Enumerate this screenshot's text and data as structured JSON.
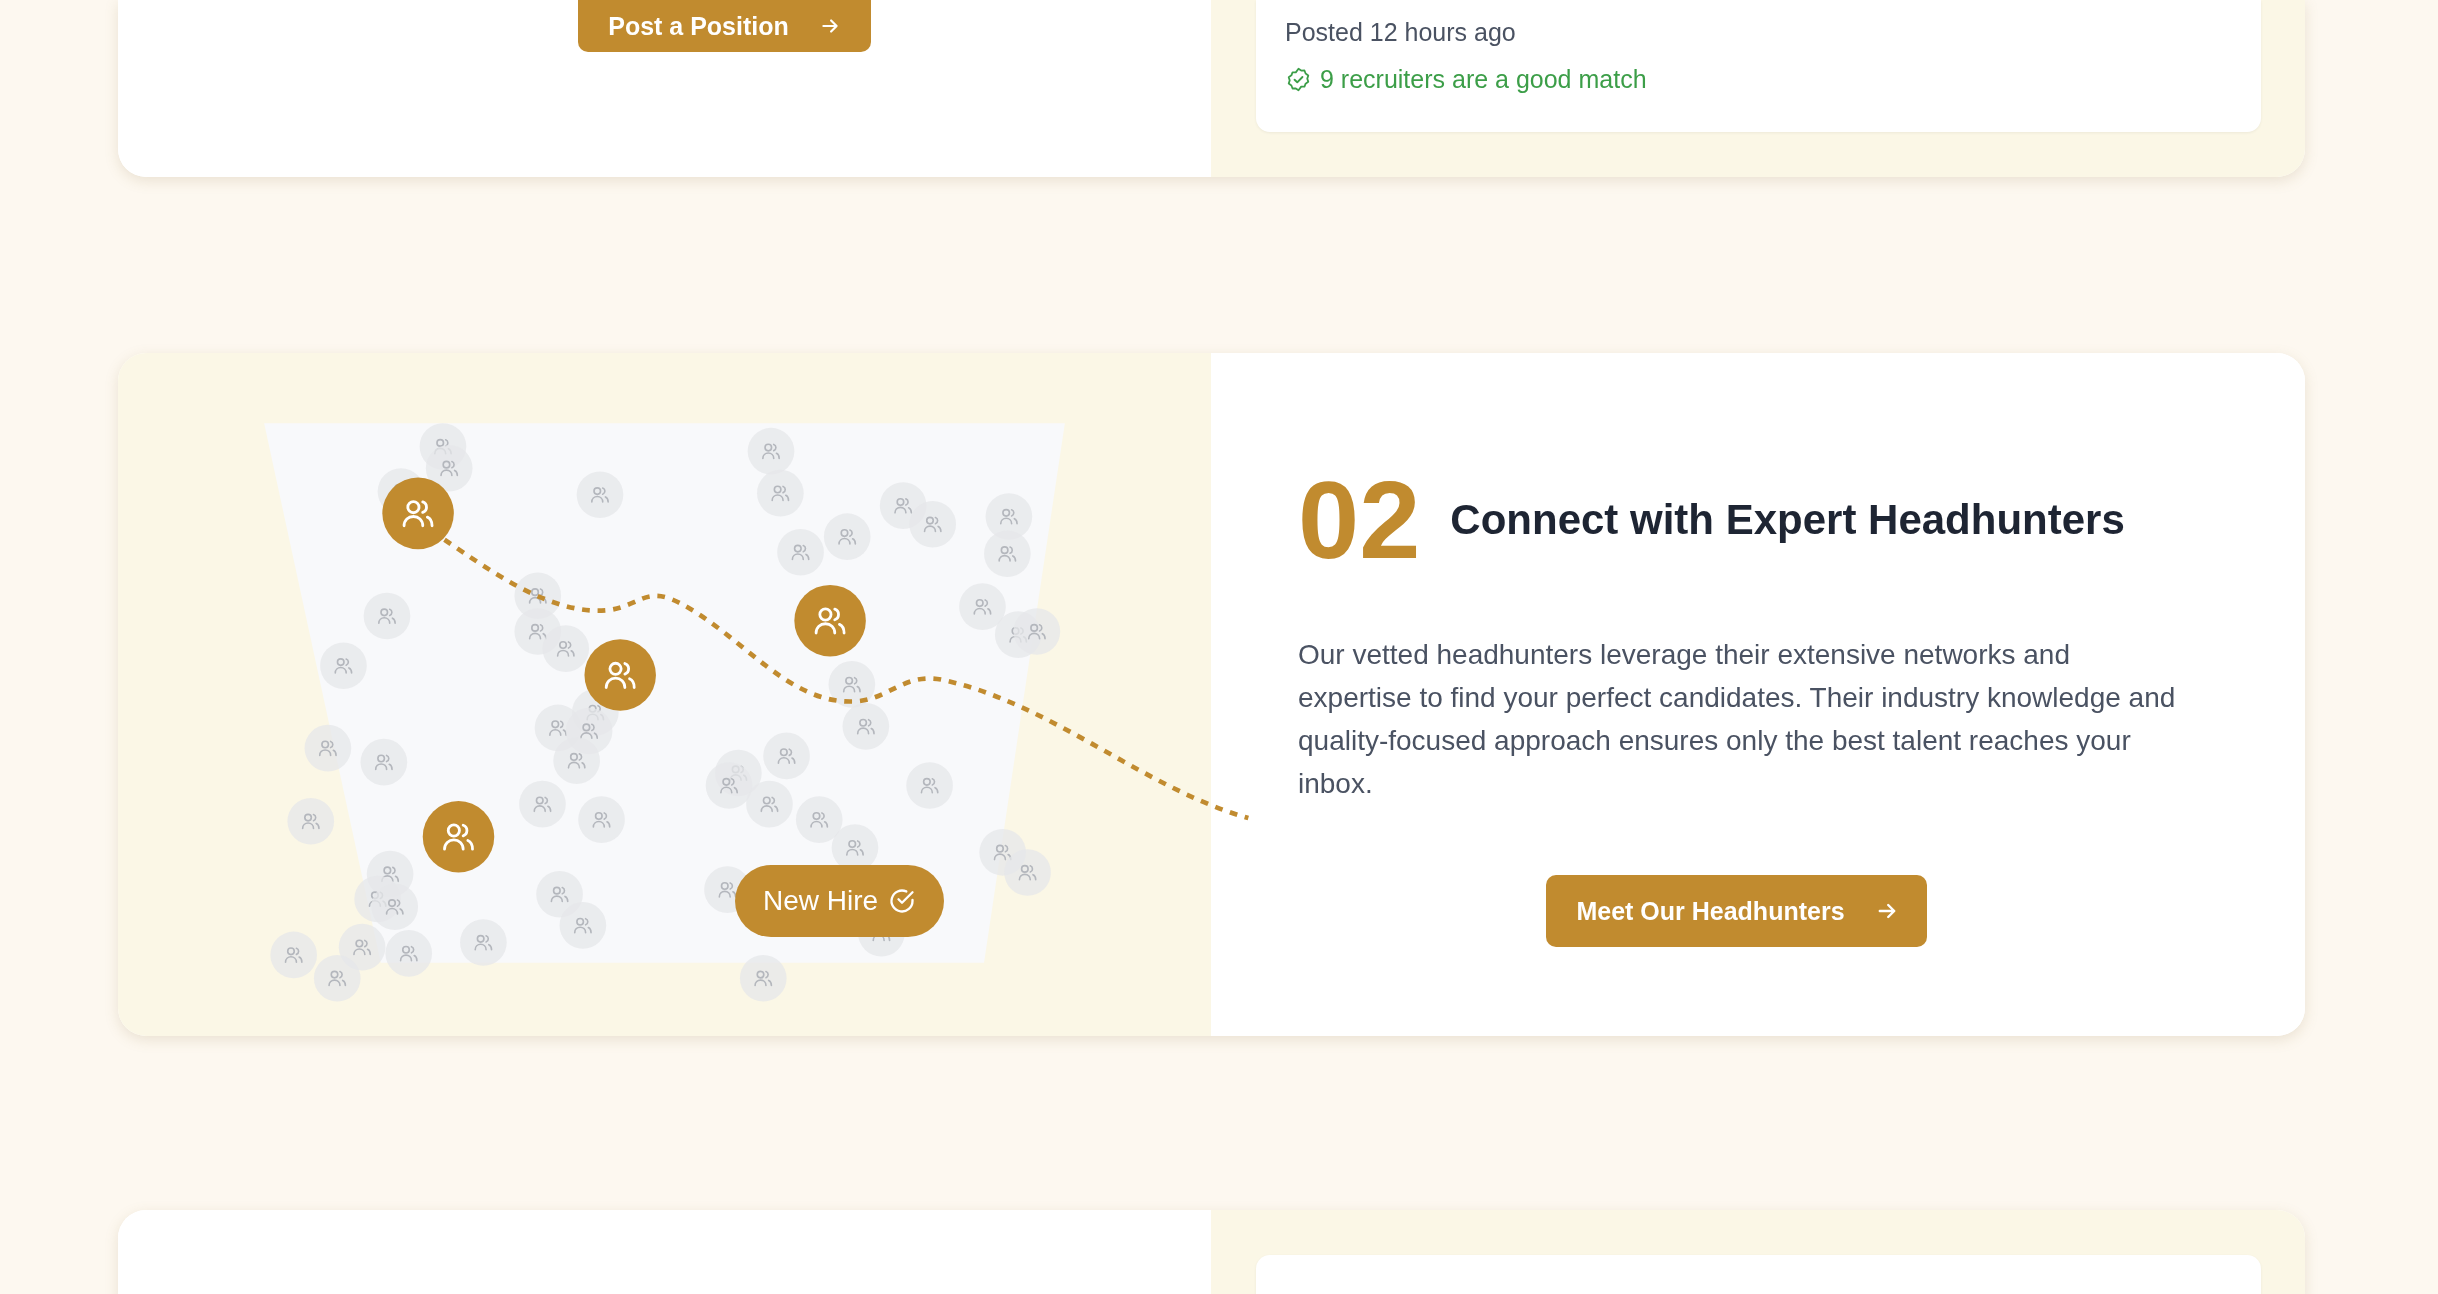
{
  "top_card": {
    "button": "Post a Position",
    "posted": "Posted 12 hours ago",
    "match": "9 recruiters are a good match"
  },
  "step": {
    "number": "02",
    "title": "Connect with Expert Headhunters",
    "body": "Our vetted headhunters leverage their extensive networks and expertise to find your perfect candidates. Their industry knowledge and quality-focused approach ensures only the best talent reaches your inbox.",
    "button": "Meet Our Headhunters",
    "badge": "New Hire"
  }
}
